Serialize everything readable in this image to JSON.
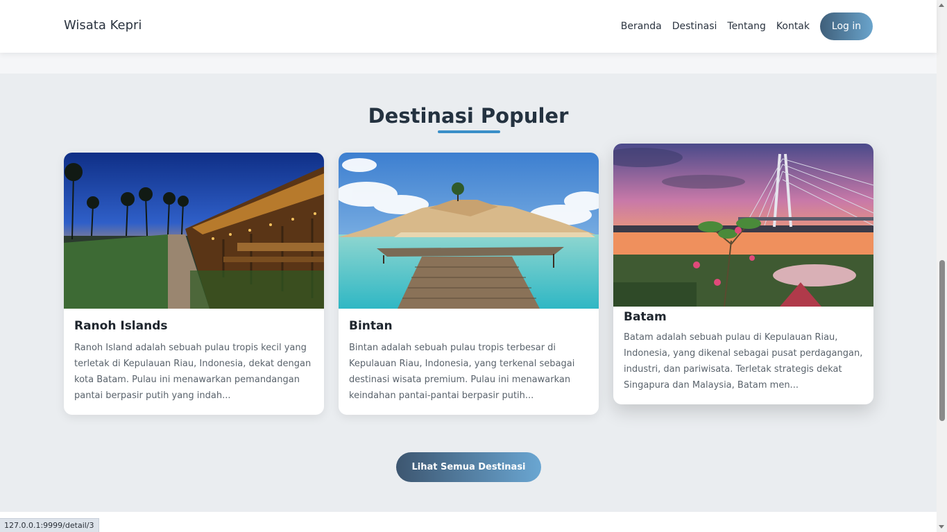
{
  "nav": {
    "brand": "Wisata Kepri",
    "links": [
      "Beranda",
      "Destinasi",
      "Tentang",
      "Kontak"
    ],
    "login": "Log in"
  },
  "section": {
    "title": "Destinasi Populer",
    "cards": [
      {
        "title": "Ranoh Islands",
        "text": "Ranoh Island adalah sebuah pulau tropis kecil yang terletak di Kepulauan Riau, Indonesia, dekat dengan kota Batam. Pulau ini menawarkan pemandangan pantai berpasir putih yang indah...",
        "image": "resort-walkway-night-photo"
      },
      {
        "title": "Bintan",
        "text": "Bintan adalah sebuah pulau tropis terbesar di Kepulauan Riau, Indonesia, yang terkenal sebagai destinasi wisata premium. Pulau ini menawarkan keindahan pantai-pantai berpasir putih...",
        "image": "turquoise-lagoon-pier-photo"
      },
      {
        "title": "Batam",
        "text": "Batam adalah sebuah pulau di Kepulauan Riau, Indonesia, yang dikenal sebagai pusat perdagangan, industri, dan pariwisata. Terletak strategis dekat Singapura dan Malaysia, Batam men...",
        "image": "barelang-bridge-sunset-photo"
      }
    ],
    "cta": "Lihat Semua Destinasi"
  },
  "status_url": "127.0.0.1:9999/detail/3",
  "colors": {
    "accent": "#3a8fc8",
    "title": "#243240",
    "section_bg": "#eaedf0"
  }
}
